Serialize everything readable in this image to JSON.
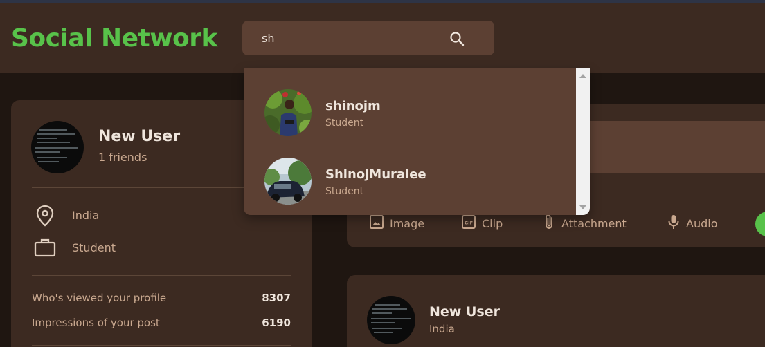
{
  "app": {
    "title": "Social Network"
  },
  "colors": {
    "brand": "#58c24a",
    "surface": "#3c2a21",
    "surface_alt": "#5c4033",
    "background": "#1f1611",
    "text": "#f0e6dd",
    "muted": "#c9a88f"
  },
  "search": {
    "value": "sh",
    "icon": "search-icon"
  },
  "search_results": [
    {
      "name": "shinojm",
      "role": "Student"
    },
    {
      "name": "ShinojMuralee",
      "role": "Student"
    }
  ],
  "profile": {
    "name": "New User",
    "friends": "1 friends",
    "location": "India",
    "occupation": "Student",
    "location_icon": "location-pin-icon",
    "occupation_icon": "briefcase-icon",
    "stats": [
      {
        "label": "Who's viewed your profile",
        "value": "8307"
      },
      {
        "label": "Impressions of your post",
        "value": "6190"
      }
    ]
  },
  "post_actions": [
    {
      "label": "Image",
      "icon": "image-icon"
    },
    {
      "label": "Clip",
      "icon": "gif-icon"
    },
    {
      "label": "Attachment",
      "icon": "paperclip-icon"
    },
    {
      "label": "Audio",
      "icon": "microphone-icon"
    }
  ],
  "feed": {
    "post": {
      "name": "New User",
      "location": "India"
    }
  }
}
